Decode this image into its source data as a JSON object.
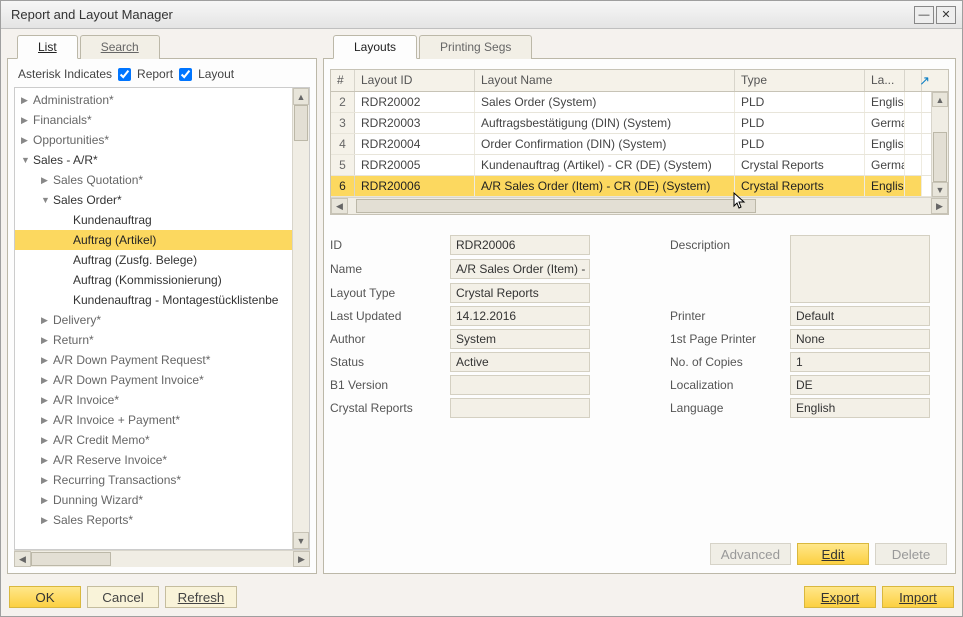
{
  "window": {
    "title": "Report and Layout Manager"
  },
  "leftTabs": {
    "list": "List",
    "search": "Search"
  },
  "rightTabs": {
    "layouts": "Layouts",
    "printingSegs": "Printing Segs"
  },
  "asterisk": {
    "label": "Asterisk Indicates",
    "reportLabel": "Report",
    "layoutLabel": "Layout"
  },
  "tree": {
    "items": [
      {
        "label": "Administration*",
        "level": 1,
        "state": "collapsed"
      },
      {
        "label": "Financials*",
        "level": 1,
        "state": "collapsed"
      },
      {
        "label": "Opportunities*",
        "level": 1,
        "state": "collapsed"
      },
      {
        "label": "Sales - A/R*",
        "level": 1,
        "state": "expanded",
        "dark": true
      },
      {
        "label": "Sales Quotation*",
        "level": 2,
        "state": "collapsed"
      },
      {
        "label": "Sales Order*",
        "level": 2,
        "state": "expanded",
        "dark": true
      },
      {
        "label": "Kundenauftrag",
        "level": 3
      },
      {
        "label": "Auftrag (Artikel)",
        "level": 3,
        "selected": true
      },
      {
        "label": "Auftrag (Zusfg. Belege)",
        "level": 3
      },
      {
        "label": "Auftrag (Kommissionierung)",
        "level": 3
      },
      {
        "label": "Kundenauftrag - Montagestücklistenbe",
        "level": 3
      },
      {
        "label": "Delivery*",
        "level": 2,
        "state": "collapsed"
      },
      {
        "label": "Return*",
        "level": 2,
        "state": "collapsed"
      },
      {
        "label": "A/R Down Payment Request*",
        "level": 2,
        "state": "collapsed"
      },
      {
        "label": "A/R Down Payment Invoice*",
        "level": 2,
        "state": "collapsed"
      },
      {
        "label": "A/R Invoice*",
        "level": 2,
        "state": "collapsed"
      },
      {
        "label": "A/R Invoice + Payment*",
        "level": 2,
        "state": "collapsed"
      },
      {
        "label": "A/R Credit Memo*",
        "level": 2,
        "state": "collapsed"
      },
      {
        "label": "A/R Reserve Invoice*",
        "level": 2,
        "state": "collapsed"
      },
      {
        "label": "Recurring Transactions*",
        "level": 2,
        "state": "collapsed"
      },
      {
        "label": "Dunning Wizard*",
        "level": 2,
        "state": "collapsed"
      },
      {
        "label": "Sales Reports*",
        "level": 2,
        "state": "collapsed"
      }
    ]
  },
  "gridHeaders": {
    "num": "#",
    "layoutId": "Layout ID",
    "layoutName": "Layout Name",
    "type": "Type",
    "lang": "La..."
  },
  "gridRows": [
    {
      "num": "2",
      "id": "RDR20002",
      "name": "Sales Order (System)",
      "type": "PLD",
      "lang": "English"
    },
    {
      "num": "3",
      "id": "RDR20003",
      "name": "Auftragsbestätigung (DIN) (System)",
      "type": "PLD",
      "lang": "Germa"
    },
    {
      "num": "4",
      "id": "RDR20004",
      "name": "Order Confirmation (DIN) (System)",
      "type": "PLD",
      "lang": "English"
    },
    {
      "num": "5",
      "id": "RDR20005",
      "name": "Kundenauftrag (Artikel) - CR (DE) (System)",
      "type": "Crystal Reports",
      "lang": "Germa"
    },
    {
      "num": "6",
      "id": "RDR20006",
      "name": "A/R Sales Order (Item) - CR (DE) (System)",
      "type": "Crystal Reports",
      "lang": "English",
      "selected": true
    }
  ],
  "form": {
    "id_lbl": "ID",
    "id_val": "RDR20006",
    "name_lbl": "Name",
    "name_val": "A/R Sales Order (Item) -",
    "layoutType_lbl": "Layout Type",
    "layoutType_val": "Crystal Reports",
    "lastUpdated_lbl": "Last Updated",
    "lastUpdated_val": "14.12.2016",
    "author_lbl": "Author",
    "author_val": "System",
    "status_lbl": "Status",
    "status_val": "Active",
    "b1version_lbl": "B1 Version",
    "b1version_val": "",
    "crystal_lbl": "Crystal Reports",
    "crystal_val": "",
    "description_lbl": "Description",
    "description_val": "",
    "printer_lbl": "Printer",
    "printer_val": "Default",
    "firstPage_lbl": "1st Page Printer",
    "firstPage_val": "None",
    "copies_lbl": "No. of Copies",
    "copies_val": "1",
    "localization_lbl": "Localization",
    "localization_val": "DE",
    "language_lbl": "Language",
    "language_val": "English"
  },
  "buttons": {
    "ok": "OK",
    "cancel": "Cancel",
    "refresh": "Refresh",
    "advanced": "Advanced",
    "edit": "Edit",
    "delete": "Delete",
    "export": "Export",
    "import": "Import"
  }
}
